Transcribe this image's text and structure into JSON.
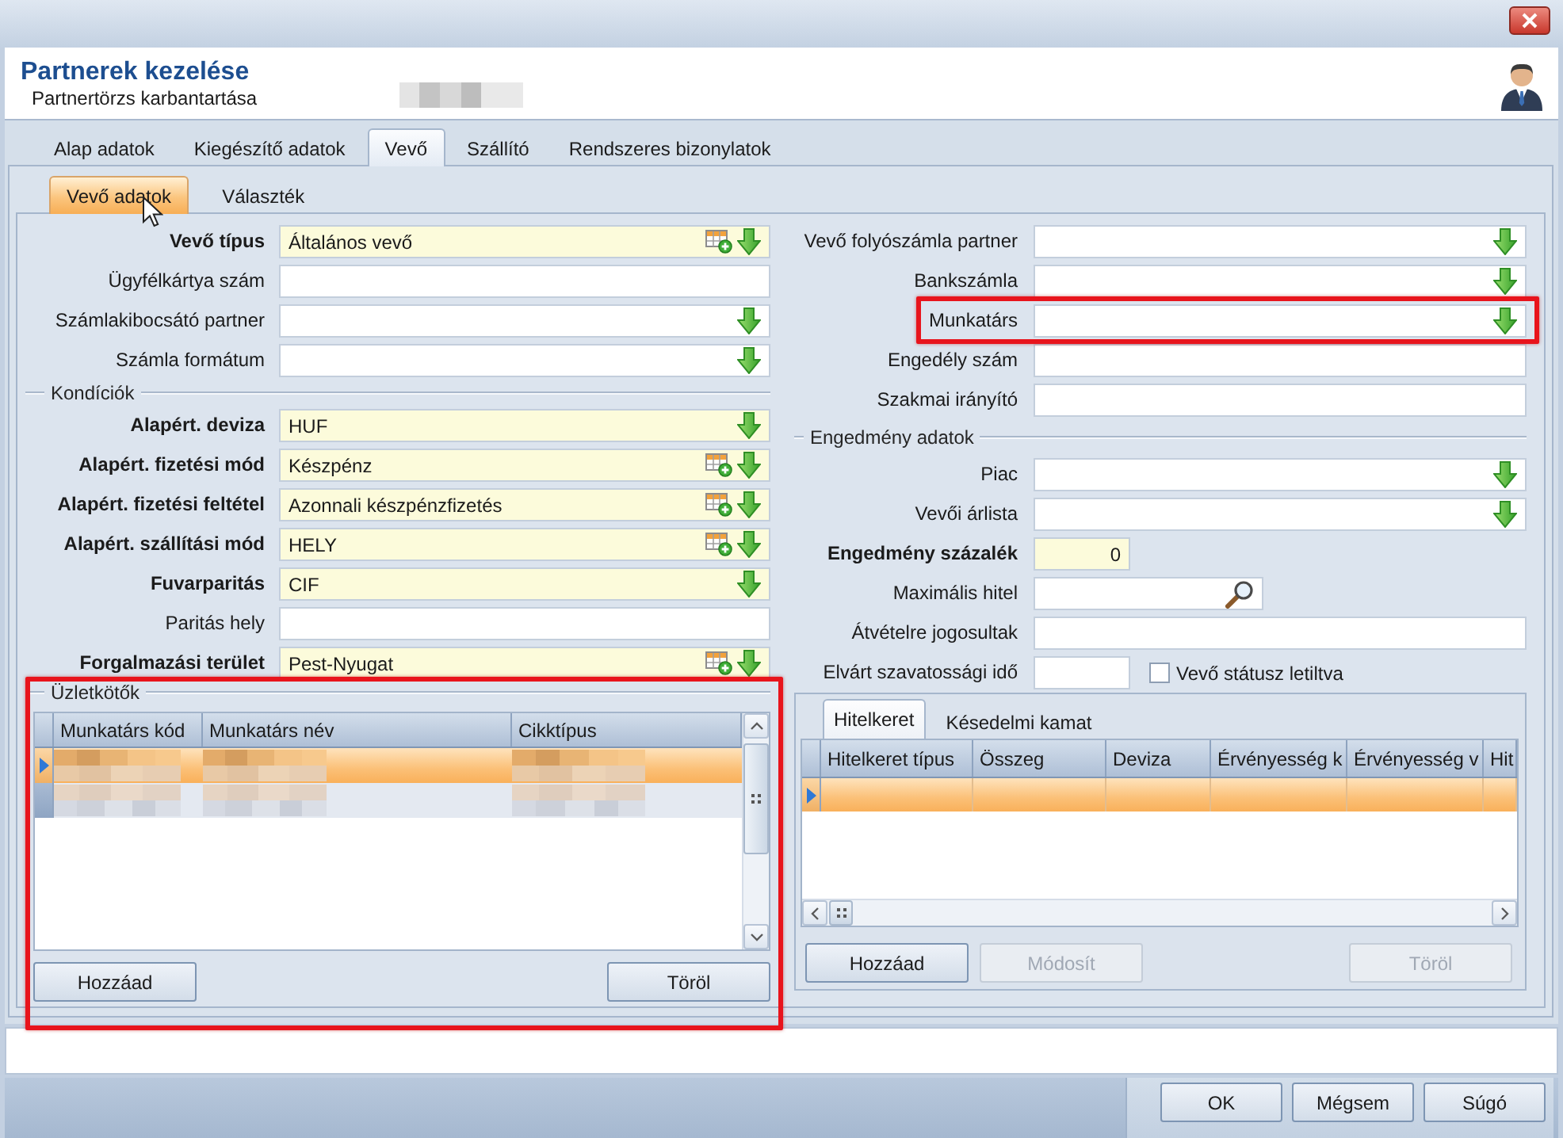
{
  "header": {
    "title": "Partnerek kezelése",
    "subtitle": "Partnertörzs karbantartása"
  },
  "tabs": [
    {
      "label": "Alap adatok",
      "selected": false
    },
    {
      "label": "Kiegészítő adatok",
      "selected": false
    },
    {
      "label": "Vevő",
      "selected": true
    },
    {
      "label": "Szállító",
      "selected": false
    },
    {
      "label": "Rendszeres bizonylatok",
      "selected": false
    }
  ],
  "subtabs": [
    {
      "label": "Vevő adatok",
      "selected": true
    },
    {
      "label": "Választék",
      "selected": false
    }
  ],
  "left_column": {
    "fields": [
      {
        "label": "Vevő típus",
        "kind": "lookup",
        "required": true,
        "value": "Általános vevő"
      },
      {
        "label": "Ügyfélkártya szám",
        "kind": "text",
        "required": false
      },
      {
        "label": "Számlakibocsátó partner",
        "kind": "select",
        "required": false
      },
      {
        "label": "Számla formátum",
        "kind": "select",
        "required": false
      }
    ],
    "conditions": {
      "title": "Kondíciók",
      "fields": [
        {
          "label": "Alapért. deviza",
          "kind": "select",
          "required": true,
          "value": "HUF"
        },
        {
          "label": "Alapért. fizetési mód",
          "kind": "lookup",
          "required": true,
          "value": "Készpénz"
        },
        {
          "label": "Alapért. fizetési feltétel",
          "kind": "lookup",
          "required": true,
          "value": "Azonnali készpénzfizetés"
        },
        {
          "label": "Alapért. szállítási mód",
          "kind": "lookup",
          "required": true,
          "value": "HELY"
        },
        {
          "label": "Fuvarparitás",
          "kind": "select",
          "required": true,
          "value": "CIF"
        },
        {
          "label": "Paritás hely",
          "kind": "text",
          "required": false
        },
        {
          "label": "Forgalmazási terület",
          "kind": "lookup",
          "required": true,
          "value": "Pest-Nyugat"
        }
      ]
    },
    "salespeople": {
      "title": "Üzletkötők",
      "highlighted": true,
      "columns": [
        "Munkatárs kód",
        "Munkatárs név",
        "Cikktípus"
      ],
      "rows": [
        {
          "selected": true
        },
        {
          "selected": false
        }
      ],
      "buttons": [
        {
          "label": "Hozzáad",
          "disabled": false
        },
        {
          "label": "Töröl",
          "disabled": false
        }
      ]
    }
  },
  "right_column": {
    "fields": [
      {
        "label": "Vevő folyószámla partner",
        "kind": "select",
        "required": false,
        "highlighted": false
      },
      {
        "label": "Bankszámla",
        "kind": "select",
        "required": false,
        "highlighted": false
      },
      {
        "label": "Munkatárs",
        "kind": "select",
        "required": false,
        "highlighted": true
      },
      {
        "label": "Engedély szám",
        "kind": "text",
        "required": false,
        "highlighted": false
      },
      {
        "label": "Szakmai irányító",
        "kind": "text",
        "required": false,
        "highlighted": false
      }
    ],
    "discount": {
      "title": "Engedmény adatok",
      "fields": [
        {
          "label": "Piac",
          "kind": "select",
          "required": false
        },
        {
          "label": "Vevői árlista",
          "kind": "select",
          "required": false
        },
        {
          "label": "Engedmény százalék",
          "kind": "number",
          "required": true,
          "value": "0"
        },
        {
          "label": "Maximális hitel",
          "kind": "search",
          "required": false
        },
        {
          "label": "Átvételre jogosultak",
          "kind": "text",
          "required": false
        },
        {
          "label": "Elvárt szavatossági idő",
          "kind": "short",
          "required": false,
          "checkbox": {
            "label": "Vevő státusz letiltva",
            "checked": false
          }
        }
      ]
    },
    "credit": {
      "tabs": [
        {
          "label": "Hitelkeret",
          "selected": true
        },
        {
          "label": "Késedelmi kamat",
          "selected": false
        }
      ],
      "columns": [
        "Hitelkeret típus",
        "Összeg",
        "Deviza",
        "Érvényesség k",
        "Érvényesség v",
        "Hit"
      ],
      "rows": [
        {
          "selected": true
        }
      ],
      "buttons": [
        {
          "label": "Hozzáad",
          "disabled": false
        },
        {
          "label": "Módosít",
          "disabled": true
        },
        {
          "label": "Töröl",
          "disabled": true
        }
      ]
    }
  },
  "footer": {
    "buttons": [
      "OK",
      "Mégsem",
      "Súgó"
    ]
  }
}
